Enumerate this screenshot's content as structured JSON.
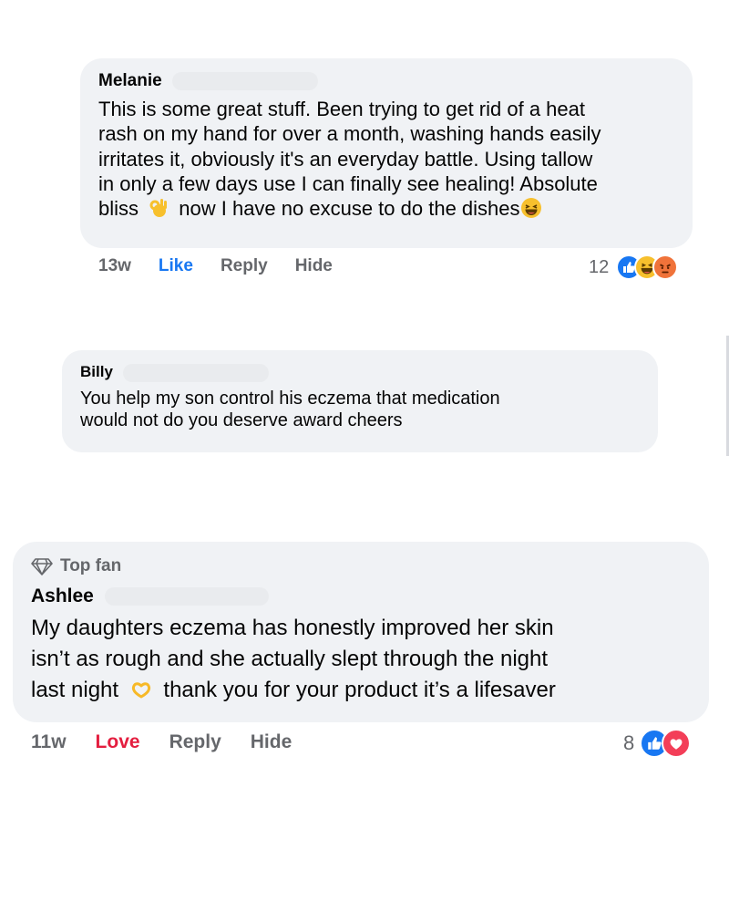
{
  "comments": [
    {
      "author": "Melanie",
      "lines": [
        "This is some great stuff. Been trying to get rid of a heat",
        "rash on my hand for over a month, washing hands easily",
        "irritates it, obviously it's an everyday battle. Using tallow",
        "in only a few days use I can finally see healing! Absolute"
      ],
      "last_line_a": "bliss",
      "last_line_b": "now I have no excuse to do the dishes",
      "time": "13w",
      "reaction_label": "Like",
      "reply": "Reply",
      "hide": "Hide",
      "reaction_count": "12"
    },
    {
      "author": "Billy",
      "lines": [
        "You help my son control his eczema that medication",
        "would not do you deserve award cheers"
      ]
    },
    {
      "badge": "Top fan",
      "author": "Ashlee",
      "lines": [
        "My daughters eczema has honestly improved her skin",
        "isn’t as rough and she actually slept through the night"
      ],
      "last_line_a": "last night",
      "last_line_b": "thank you for your product it’s a lifesaver",
      "time": "11w",
      "reaction_label": "Love",
      "reply": "Reply",
      "hide": "Hide",
      "reaction_count": "8"
    }
  ],
  "colors": {
    "like_blue": "#1877f2",
    "love_red": "#e41e3f",
    "bubble": "#f0f2f5",
    "meta_gray": "#65676b"
  },
  "icons": [
    "ok-hand-emoji-icon",
    "laughing-emoji-icon",
    "like-reaction-icon",
    "haha-reaction-icon",
    "angry-reaction-icon",
    "diamond-icon",
    "heart-hands-emoji-icon",
    "love-reaction-icon"
  ]
}
